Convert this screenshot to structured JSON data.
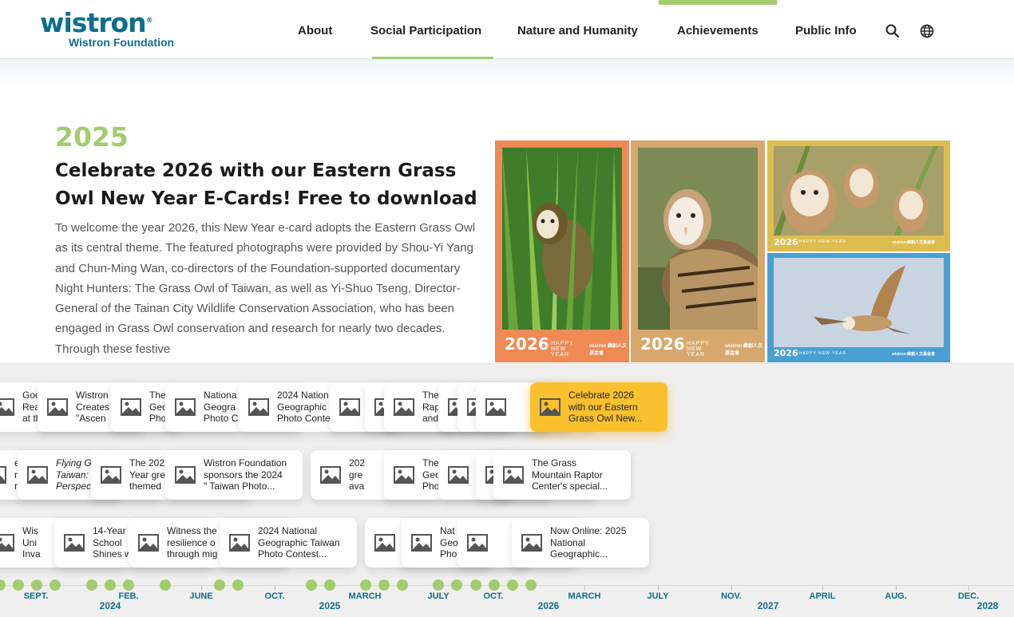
{
  "header": {
    "logo_word": "wistron",
    "logo_reg": "®",
    "logo_sub": "Wistron Foundation",
    "nav": [
      {
        "label": "About"
      },
      {
        "label": "Social Participation"
      },
      {
        "label": "Nature and Humanity"
      },
      {
        "label": "Achievements"
      },
      {
        "label": "Public Info"
      }
    ],
    "icons": [
      "search-icon",
      "globe-icon"
    ]
  },
  "article": {
    "year": "2025",
    "title": "Celebrate 2026 with our Eastern Grass Owl New Year E-Cards! Free to download",
    "body": "To welcome the year 2026, this New Year e-card adopts the Eastern Grass Owl as its central theme. The featured photographs were provided by Shou-Yi Yang and Chun-Ming Wan, co-directors of the Foundation-supported documentary Night Hunters: The Grass Owl of Taiwan, as well as Yi-Shuo Tseng, Director-General of the Tainan City Wildlife Conservation Association, who has been engaged in Grass Owl conservation and research for nearly two decades. Through these festive"
  },
  "ecards": {
    "year": "2026",
    "hny": "HAPPY NEW YEAR",
    "brand": "wistron 緯創人文基金會",
    "colors": [
      "#ef8a55",
      "#d7a86e",
      "#ddbd4e",
      "#4a9fd2"
    ]
  },
  "timeline": {
    "row1": [
      {
        "text": "Goo\nRea\nat th",
        "italic": false
      },
      {
        "text": "Wistron\nCreates\n\"Ascen",
        "italic": false
      },
      {
        "text": "The\nGeo\nPho",
        "italic": false
      },
      {
        "text": "Nationa\nGeogra\nPhoto C",
        "italic": false
      },
      {
        "text": "2024 Nation\nGeographic\nPhoto Conte",
        "italic": false
      },
      {
        "text": "",
        "italic": false
      },
      {
        "text": "",
        "italic": false
      },
      {
        "text": "The\nRap\nand",
        "italic": false
      },
      {
        "text": "",
        "italic": false
      },
      {
        "text": "",
        "italic": false
      },
      {
        "text": "",
        "italic": false
      },
      {
        "text": "Celebrate 2026\nwith our Eastern\nGrass Owl New...",
        "italic": false,
        "active": true
      }
    ],
    "row2": [
      {
        "text": "e Wis\nnda\nnso",
        "italic": false
      },
      {
        "text": "Flying G\nTaiwan:\nPerspec",
        "italic": true
      },
      {
        "text": "The 202\nYear gre\nthemed",
        "italic": false
      },
      {
        "text": "Wistron Foundation\nsponsors the 2024\n\" Taiwan Photo...",
        "italic": false
      },
      {
        "text": "202\ngre\nava",
        "italic": false
      },
      {
        "text": "The\nGeo\nPho",
        "italic": false
      },
      {
        "text": "",
        "italic": false
      },
      {
        "text": "",
        "italic": false
      },
      {
        "text": "The Grass\nMountain Raptor\nCenter's special...",
        "italic": false
      }
    ],
    "row3": [
      {
        "text": "Wis\nUni\nInva",
        "italic": false
      },
      {
        "text": "14-Year\nSchool\nShines w",
        "italic": false
      },
      {
        "text": "Witness the\nresilience o\nthrough mig",
        "italic": false
      },
      {
        "text": "2024 National\nGeographic Taiwan\nPhoto Contest...",
        "italic": false
      },
      {
        "text": "",
        "italic": false
      },
      {
        "text": "Nat\nGeo\nPho",
        "italic": false
      },
      {
        "text": "",
        "italic": false
      },
      {
        "text": "Now Online: 2025\nNational\nGeographic...",
        "italic": false
      }
    ],
    "months": [
      "SEPT.",
      "FEB.",
      "JUNE",
      "OCT.",
      "MARCH",
      "JULY",
      "OCT.",
      "MARCH",
      "JULY",
      "NOV.",
      "APRIL",
      "AUG.",
      "DEC."
    ],
    "years": [
      "2024",
      "2025",
      "2026",
      "2027",
      "2028"
    ],
    "accent": "#a3cc6d",
    "highlight": "#fbc02d",
    "label_color": "#0f6e8c"
  }
}
